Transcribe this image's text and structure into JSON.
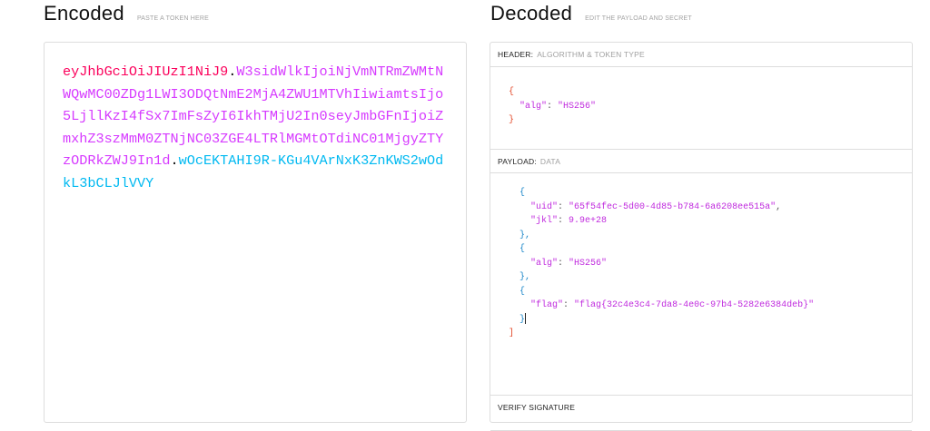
{
  "encoded": {
    "title": "Encoded",
    "subtitle": "PASTE A TOKEN HERE",
    "token_header": "eyJhbGciOiJIUzI1NiJ9",
    "dot1": ".",
    "token_payload": "W3sidWlkIjoiNjVmNTRmZWMtNWQwMC00ZDg1LWI3ODQtNmE2MjA4ZWU1MTVhIiwiamtsIjo5LjllKzI4fSx7ImFsZyI6IkhTMjU2In0seyJmbGFnIjoiZmxhZ3szMmM0ZTNjNC03ZGE4LTRlMGMtOTdiNC01MjgyZTYzODRkZWJ9In1d",
    "dot2": ".",
    "token_signature": "wOcEKTAHI9R-KGu4VArNxK3ZnKWS2wOdkL3bCLJlVVY"
  },
  "decoded": {
    "title": "Decoded",
    "subtitle": "EDIT THE PAYLOAD AND SECRET",
    "header_label": "HEADER:",
    "header_sub": "ALGORITHM & TOKEN TYPE",
    "header_json": {
      "open": "{",
      "alg_key": "\"alg\"",
      "alg_value": "\"HS256\"",
      "close": "}"
    },
    "payload_label": "PAYLOAD:",
    "payload_sub": "DATA",
    "payload_json": {
      "obj1_open": "{",
      "uid_key": "\"uid\"",
      "uid_value": "\"65f54fec-5d00-4d85-b784-6a6208ee515a\"",
      "jkl_key": "\"jkl\"",
      "jkl_value": "9.9e+28",
      "obj1_close": "},",
      "obj2_open": "{",
      "alg_key": "\"alg\"",
      "alg_value": "\"HS256\"",
      "obj2_close": "},",
      "obj3_open": "{",
      "flag_key": "\"flag\"",
      "flag_value": "\"flag{32c4e3c4-7da8-4e0c-97b4-5282e6384deb}\"",
      "obj3_close": "}",
      "array_close": "]"
    },
    "verify_label": "VERIFY SIGNATURE"
  },
  "colors": {
    "header": "#fb015b",
    "payload": "#d63aff",
    "signature": "#00b9f1"
  }
}
